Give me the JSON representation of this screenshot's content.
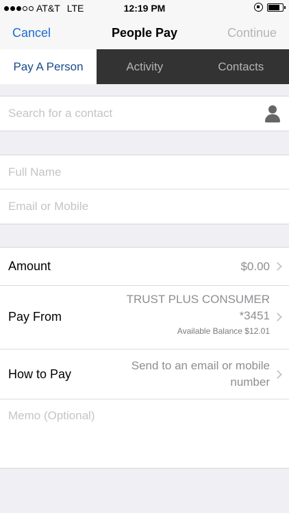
{
  "status": {
    "carrier": "AT&T",
    "network": "LTE",
    "time": "12:19 PM",
    "signal_bars": 3,
    "signal_total": 5
  },
  "nav": {
    "cancel": "Cancel",
    "title": "People Pay",
    "continue": "Continue"
  },
  "tabs": [
    {
      "label": "Pay A Person",
      "active": true
    },
    {
      "label": "Activity",
      "active": false
    },
    {
      "label": "Contacts",
      "active": false
    }
  ],
  "search": {
    "placeholder": "Search for a contact",
    "icon": "person-icon"
  },
  "recipient": {
    "full_name_placeholder": "Full Name",
    "email_mobile_placeholder": "Email or Mobile"
  },
  "payment": {
    "amount_label": "Amount",
    "amount_value": "$0.00",
    "pay_from_label": "Pay From",
    "pay_from_account": "TRUST PLUS CONSUMER",
    "pay_from_number": "*3451",
    "available_balance": "Available Balance $12.01",
    "how_to_pay_label": "How to Pay",
    "how_to_pay_line1": "Send to an email or mobile",
    "how_to_pay_line2": "number"
  },
  "memo": {
    "placeholder": "Memo (Optional)"
  },
  "colors": {
    "accent": "#1a6dd0",
    "tab_bar": "#333333",
    "background": "#efeff4"
  }
}
